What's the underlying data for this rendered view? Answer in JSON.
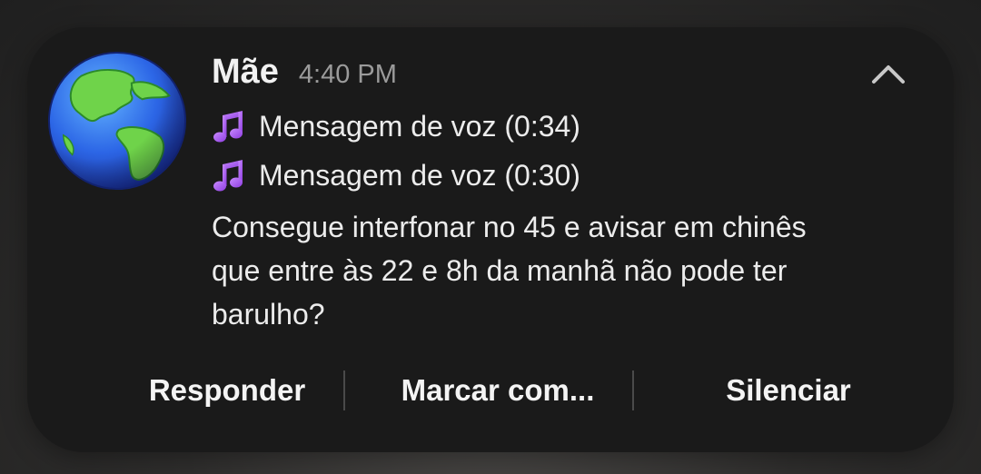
{
  "notification": {
    "sender": "Mãe",
    "time": "4:40 PM",
    "avatar_icon": "globe-americas-emoji",
    "collapse_icon": "chevron-up-icon",
    "voice_messages": [
      {
        "icon": "musical-note-emoji",
        "label": "Mensagem de voz (0:34)"
      },
      {
        "icon": "musical-note-emoji",
        "label": "Mensagem de voz (0:30)"
      }
    ],
    "text_message": "Consegue interfonar no 45 e avisar em chinês que entre às 22 e 8h da manhã não pode ter barulho?",
    "actions": {
      "reply": "Responder",
      "mark": "Marcar com...",
      "mute": "Silenciar"
    }
  },
  "colors": {
    "card_background": "#1a1a1a",
    "note_purple": "#b35cf0",
    "time_gray": "#9b9b9b"
  }
}
